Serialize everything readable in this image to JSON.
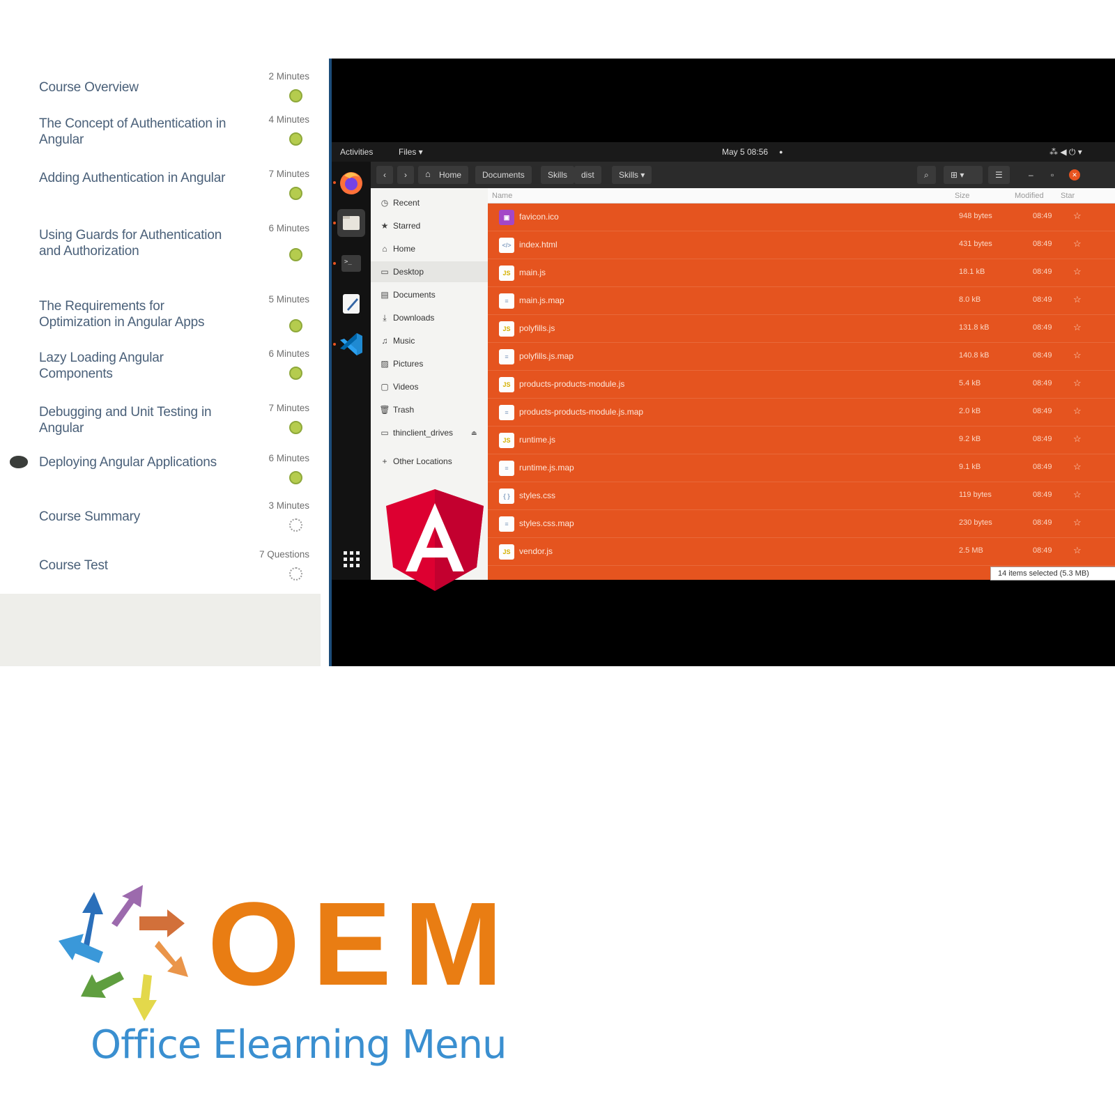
{
  "course": {
    "lessons": [
      {
        "title": "Course Overview",
        "duration": "2 Minutes",
        "status": "complete"
      },
      {
        "title": "The Concept of Authentication in Angular",
        "duration": "4 Minutes",
        "status": "complete"
      },
      {
        "title": "Adding Authentication in Angular",
        "duration": "7 Minutes",
        "status": "complete"
      },
      {
        "title": "Using Guards for Authentication and Authorization",
        "duration": "6 Minutes",
        "status": "complete"
      },
      {
        "title": "The Requirements for Optimization in Angular Apps",
        "duration": "5 Minutes",
        "status": "complete"
      },
      {
        "title": "Lazy Loading Angular Components",
        "duration": "6 Minutes",
        "status": "complete"
      },
      {
        "title": "Debugging and Unit Testing in Angular",
        "duration": "7 Minutes",
        "status": "complete"
      },
      {
        "title": "Deploying Angular Applications",
        "duration": "6 Minutes",
        "status": "complete",
        "current": true
      },
      {
        "title": "Course Summary",
        "duration": "3 Minutes",
        "status": "not-started"
      },
      {
        "title": "Course Test",
        "duration": "7 Questions",
        "status": "not-started"
      }
    ]
  },
  "desktop": {
    "topbar": {
      "activities": "Activities",
      "app_menu": "Files ▾",
      "clock": "May 5  08:56",
      "clock_dot": "●",
      "tray": "⁂ ◀ ⏻ ▾"
    },
    "dock": [
      "firefox-icon",
      "files-icon",
      "terminal-icon",
      "text-editor-icon",
      "vscode-icon",
      "app-grid-icon"
    ],
    "headerbar": {
      "back": "‹",
      "forward": "›",
      "breadcrumbs": [
        "Home",
        "Documents",
        "Skills",
        "dist",
        "Skills ▾"
      ],
      "search": "⌕",
      "view": "⊞ ▾",
      "menu": "☰",
      "minimize": "–",
      "maximize": "▫",
      "close": "✕"
    },
    "places": [
      {
        "icon": "◷",
        "label": "Recent"
      },
      {
        "icon": "★",
        "label": "Starred"
      },
      {
        "icon": "⌂",
        "label": "Home"
      },
      {
        "icon": "▭",
        "label": "Desktop",
        "selected": true
      },
      {
        "icon": "▤",
        "label": "Documents"
      },
      {
        "icon": "⤓",
        "label": "Downloads"
      },
      {
        "icon": "♫",
        "label": "Music"
      },
      {
        "icon": "▨",
        "label": "Pictures"
      },
      {
        "icon": "▢",
        "label": "Videos"
      },
      {
        "icon": "🗑",
        "label": "Trash"
      },
      {
        "icon": "▭",
        "label": "thinclient_drives",
        "eject": "⏏"
      },
      {
        "icon": "+",
        "label": "Other Locations"
      }
    ],
    "columns": {
      "name": "Name",
      "size": "Size",
      "modified": "Modified",
      "star": "Star"
    },
    "files": [
      {
        "name": "favicon.ico",
        "size": "948 bytes",
        "modified": "08:49",
        "type": "image"
      },
      {
        "name": "index.html",
        "size": "431 bytes",
        "modified": "08:49",
        "type": "html"
      },
      {
        "name": "main.js",
        "size": "18.1 kB",
        "modified": "08:49",
        "type": "js"
      },
      {
        "name": "main.js.map",
        "size": "8.0 kB",
        "modified": "08:49",
        "type": "map"
      },
      {
        "name": "polyfills.js",
        "size": "131.8 kB",
        "modified": "08:49",
        "type": "js"
      },
      {
        "name": "polyfills.js.map",
        "size": "140.8 kB",
        "modified": "08:49",
        "type": "map"
      },
      {
        "name": "products-products-module.js",
        "size": "5.4 kB",
        "modified": "08:49",
        "type": "js"
      },
      {
        "name": "products-products-module.js.map",
        "size": "2.0 kB",
        "modified": "08:49",
        "type": "map"
      },
      {
        "name": "runtime.js",
        "size": "9.2 kB",
        "modified": "08:49",
        "type": "js"
      },
      {
        "name": "runtime.js.map",
        "size": "9.1 kB",
        "modified": "08:49",
        "type": "map"
      },
      {
        "name": "styles.css",
        "size": "119 bytes",
        "modified": "08:49",
        "type": "css"
      },
      {
        "name": "styles.css.map",
        "size": "230 bytes",
        "modified": "08:49",
        "type": "map"
      },
      {
        "name": "vendor.js",
        "size": "2.5 MB",
        "modified": "08:49",
        "type": "js"
      }
    ],
    "selection_status": "14 items selected  (5.3 MB)",
    "selection_color": "#e5541f"
  },
  "logo": {
    "mark": "OEM",
    "tagline": "Office Elearning Menu",
    "brand_orange": "#e97d13",
    "brand_blue": "#3a8fd0"
  }
}
